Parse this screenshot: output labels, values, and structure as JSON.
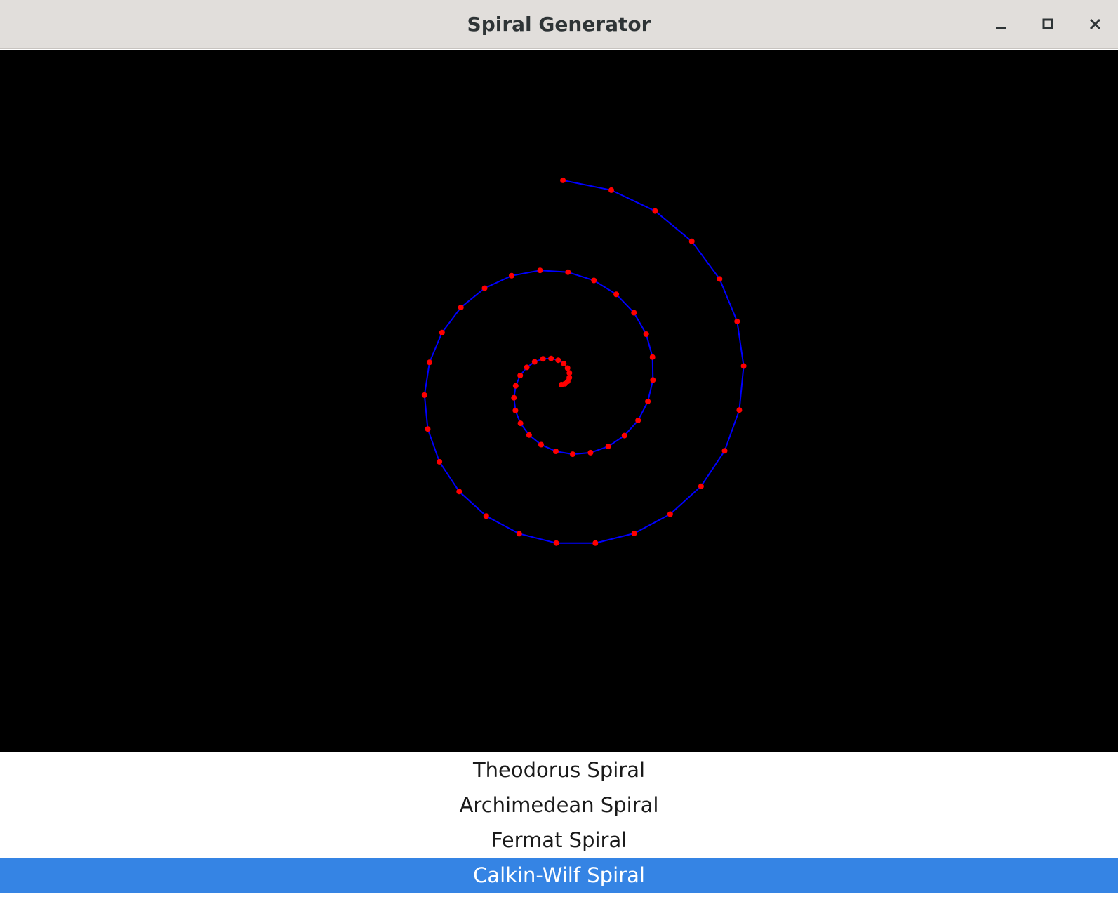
{
  "window": {
    "title": "Spiral Generator",
    "controls": [
      "minimize-icon",
      "maximize-icon",
      "close-icon"
    ]
  },
  "canvas": {
    "background": "#000000",
    "line_color": "#0000ff",
    "point_color": "#ff0000"
  },
  "spiral_list": {
    "items": [
      {
        "label": "Theodorus Spiral",
        "selected": false
      },
      {
        "label": "Archimedean Spiral",
        "selected": false
      },
      {
        "label": "Fermat Spiral",
        "selected": false
      },
      {
        "label": "Calkin-Wilf Spiral",
        "selected": true
      }
    ],
    "selected_color": "#3584e4"
  }
}
